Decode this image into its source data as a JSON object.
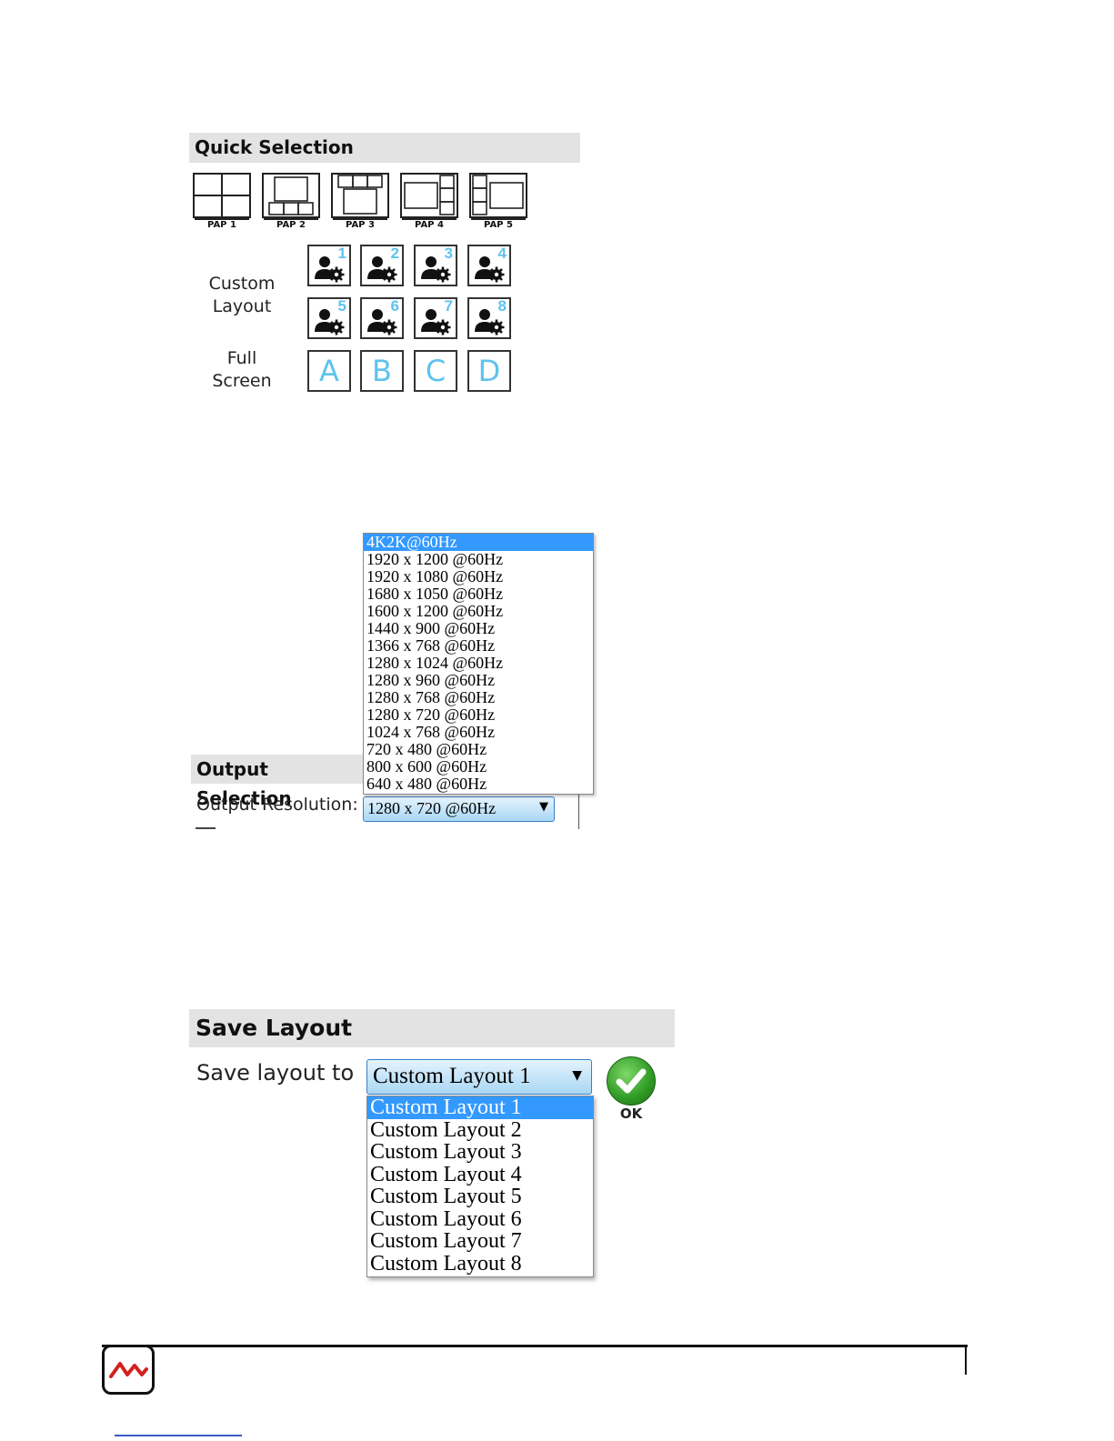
{
  "quick_selection": {
    "title": "Quick Selection",
    "pap_presets": [
      {
        "label": "PAP 1",
        "icon": "pap-quad-icon"
      },
      {
        "label": "PAP 2",
        "icon": "pap-large-top-three-bottom-icon"
      },
      {
        "label": "PAP 3",
        "icon": "pap-three-top-large-bottom-icon"
      },
      {
        "label": "PAP 4",
        "icon": "pap-large-left-three-right-icon"
      },
      {
        "label": "PAP 5",
        "icon": "pap-three-left-large-right-icon"
      }
    ],
    "custom_layout_label_line1": "Custom",
    "custom_layout_label_line2": "Layout",
    "custom_layouts": [
      "1",
      "2",
      "3",
      "4",
      "5",
      "6",
      "7",
      "8"
    ],
    "custom_layout_icon": "user-gear-icon",
    "full_screen_label_line1": "Full",
    "full_screen_label_line2": "Screen",
    "full_screen_sources": [
      "A",
      "B",
      "C",
      "D"
    ],
    "accent_color": "#5ec3ee"
  },
  "output_selection": {
    "title": "Output Selection",
    "resolution_label": "Output Resolution:",
    "resolution_selected": "1280 x 720 @60Hz",
    "resolution_options": [
      "4K2K@60Hz",
      "1920 x 1200 @60Hz",
      "1920 x 1080 @60Hz",
      "1680 x 1050 @60Hz",
      "1600 x 1200 @60Hz",
      "1440 x 900 @60Hz",
      "1366 x 768 @60Hz",
      "1280 x 1024 @60Hz",
      "1280 x 960 @60Hz",
      "1280 x 768 @60Hz",
      "1280 x 720 @60Hz",
      "1024 x 768 @60Hz",
      "720 x 480 @60Hz",
      "800 x 600 @60Hz",
      "640 x 480 @60Hz"
    ],
    "highlighted_option": "4K2K@60Hz",
    "highlight_color": "#3399ff"
  },
  "save_layout": {
    "title": "Save Layout",
    "label": "Save layout to",
    "selected": "Custom Layout 1",
    "options": [
      "Custom Layout 1",
      "Custom Layout 2",
      "Custom Layout 3",
      "Custom Layout 4",
      "Custom Layout 5",
      "Custom Layout 6",
      "Custom Layout 7",
      "Custom Layout 8"
    ],
    "highlighted_option": "Custom Layout 1",
    "ok_label": "OK",
    "ok_icon": "checkmark-icon",
    "ok_color": "#2e9a24"
  },
  "footer": {
    "logo_icon": "brand-wave-logo",
    "logo_color": "#d42020"
  }
}
